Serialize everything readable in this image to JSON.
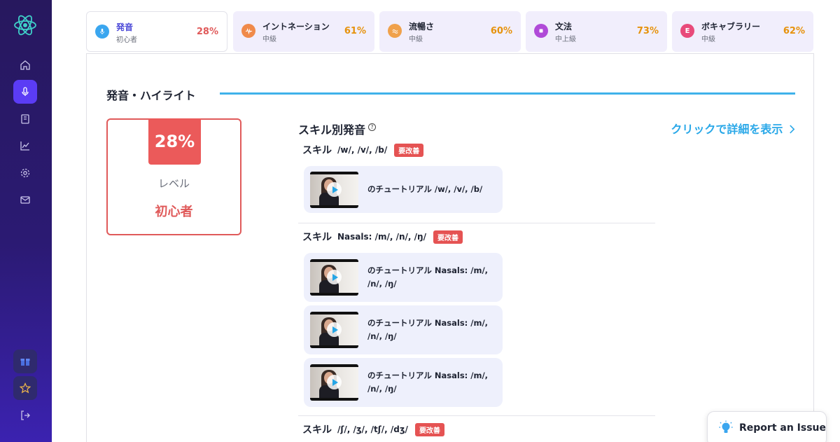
{
  "tabs": [
    {
      "title": "発音",
      "level": "初心者",
      "percent": "28%",
      "color": "#e05a5a",
      "icon_bg": "#3aa6ef",
      "icon": "mic-icon",
      "active": true
    },
    {
      "title": "イントネーション",
      "level": "中級",
      "percent": "61%",
      "color": "#e6920c",
      "icon_bg": "#f08a4a",
      "icon": "wave-icon",
      "active": false
    },
    {
      "title": "流暢さ",
      "level": "中級",
      "percent": "60%",
      "color": "#e6920c",
      "icon_bg": "#f0a14b",
      "icon": "approx-icon",
      "active": false
    },
    {
      "title": "文法",
      "level": "中上級",
      "percent": "73%",
      "color": "#e6920c",
      "icon_bg": "#b04ad8",
      "icon": "square-icon",
      "active": false
    },
    {
      "title": "ボキャブラリー",
      "level": "中級",
      "percent": "62%",
      "color": "#e6920c",
      "icon_bg": "#e84a7a",
      "icon": "letter-e-icon",
      "icon_text": "E",
      "active": false
    }
  ],
  "panel": {
    "title": "発音・ハイライト",
    "level_box": {
      "percent": "28%",
      "label": "レベル",
      "value": "初心者"
    },
    "section_title": "スキル別発音",
    "help_icon": "?",
    "details_link": "クリックで詳細を表示"
  },
  "skills": [
    {
      "prefix": "スキル",
      "name": "/w/, /v/, /b/",
      "badge": "要改善",
      "videos": [
        {
          "text": "のチュートリアル /w/, /v/, /b/"
        }
      ]
    },
    {
      "prefix": "スキル",
      "name": "Nasals: /m/, /n/, /ŋ/",
      "badge": "要改善",
      "videos": [
        {
          "text": "のチュートリアル Nasals: /m/, /n/, /ŋ/"
        },
        {
          "text": "のチュートリアル Nasals: /m/, /n/, /ŋ/"
        },
        {
          "text": "のチュートリアル Nasals: /m/, /n/, /ŋ/"
        }
      ]
    },
    {
      "prefix": "スキル",
      "name": "/ʃ/, /ʒ/, /tʃ/, /dʒ/",
      "badge": "要改善",
      "videos": []
    }
  ],
  "report": {
    "label": "Report an Issue"
  },
  "colors": {
    "accent": "#5b3cf5",
    "danger": "#e05a5a",
    "link": "#2aa8e8",
    "line": "#3fb2ea"
  }
}
